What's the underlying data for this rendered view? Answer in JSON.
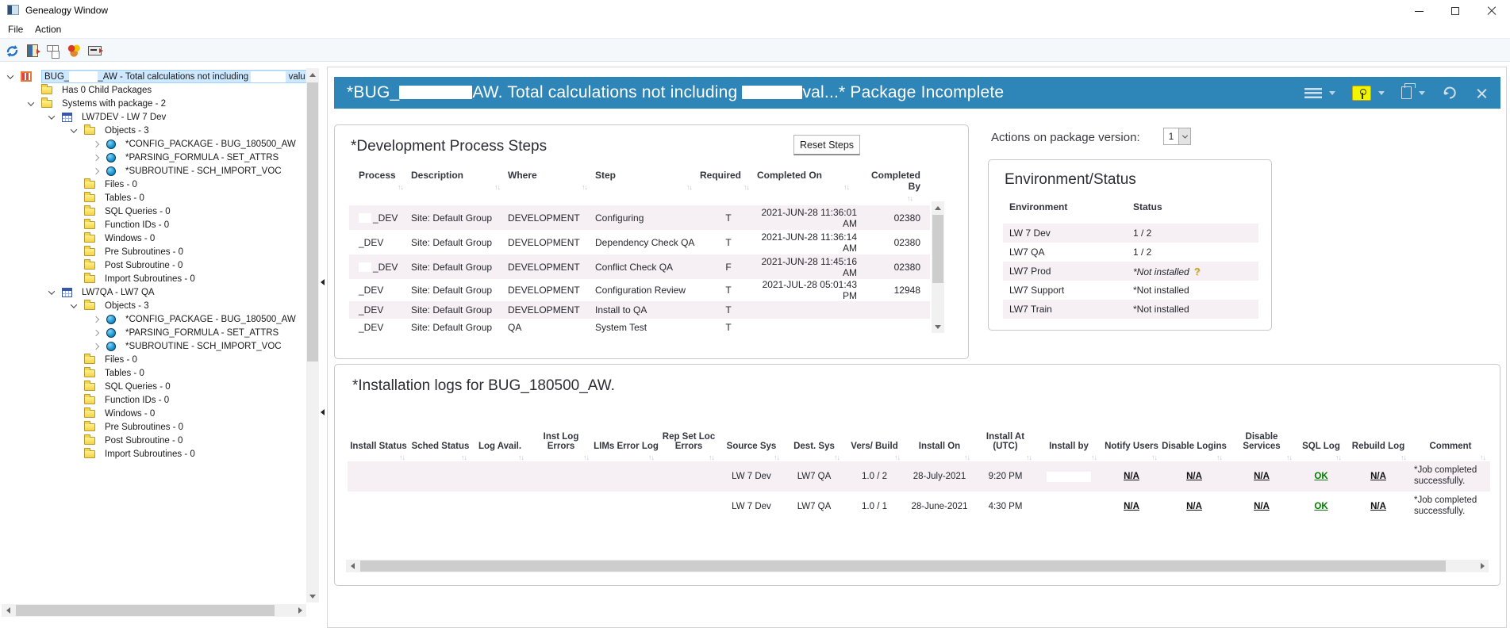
{
  "window": {
    "title": "Genealogy Window"
  },
  "menu": {
    "file": "File",
    "action": "Action"
  },
  "icons": {
    "sort": "↑↓",
    "help": "?"
  },
  "colors": {
    "accent_blue": "#2E86B8",
    "status_dot_green": "#17A24B",
    "ok_link_green": "#007D00",
    "highlight_yellow": "#F2F500",
    "row_alt": "#F6F0F4"
  },
  "tree": {
    "root_pre": "BUG_",
    "root_mid": "_AW - Total calculations not including",
    "root_post": "valu",
    "items": [
      "Has 0 Child Packages",
      "Systems with package - 2",
      "LW7DEV - LW 7 Dev",
      "Objects - 3",
      "*CONFIG_PACKAGE - BUG_180500_AW",
      "*PARSING_FORMULA - SET_ATTRS",
      "*SUBROUTINE - SCH_IMPORT_VOC",
      "Files - 0",
      "Tables - 0",
      "SQL Queries - 0",
      "Function IDs - 0",
      "Windows - 0",
      "Pre Subroutines - 0",
      "Post Subroutine - 0",
      "Import Subroutines - 0",
      "LW7QA - LW7 QA",
      "Objects - 3",
      "*CONFIG_PACKAGE - BUG_180500_AW",
      "*PARSING_FORMULA - SET_ATTRS",
      "*SUBROUTINE - SCH_IMPORT_VOC",
      "Files - 0",
      "Tables - 0",
      "SQL Queries - 0",
      "Function IDs - 0",
      "Windows - 0",
      "Pre Subroutines - 0",
      "Post Subroutine - 0",
      "Import Subroutines - 0"
    ]
  },
  "header": {
    "pre": "*BUG_",
    "mid": "AW. Total calculations not including",
    "post": "val...* Package Incomplete"
  },
  "dev_steps": {
    "title": "*Development Process Steps",
    "reset_button": "Reset Steps",
    "columns": [
      "Process",
      "Description",
      "Where",
      "Step",
      "Required",
      "Completed On",
      "Completed By"
    ],
    "rows": [
      {
        "process": "_DEV",
        "description": "Site: Default Group",
        "where": "DEVELOPMENT",
        "step": "Configuring",
        "required": "T",
        "completed_on": "2021-JUN-28 11:36:01 AM",
        "completed_by": "02380"
      },
      {
        "process": "_DEV",
        "description": "Site: Default Group",
        "where": "DEVELOPMENT",
        "step": "Dependency Check QA",
        "required": "T",
        "completed_on": "2021-JUN-28 11:36:14 AM",
        "completed_by": "02380"
      },
      {
        "process": "_DEV",
        "description": "Site: Default Group",
        "where": "DEVELOPMENT",
        "step": "Conflict Check QA",
        "required": "F",
        "completed_on": "2021-JUN-28 11:45:16 AM",
        "completed_by": "02380"
      },
      {
        "process": "_DEV",
        "description": "Site: Default Group",
        "where": "DEVELOPMENT",
        "step": "Configuration Review",
        "required": "T",
        "completed_on": "2021-JUL-28 05:01:43 PM",
        "completed_by": "12948"
      },
      {
        "process": "_DEV",
        "description": "Site: Default Group",
        "where": "DEVELOPMENT",
        "step": "Install to QA",
        "required": "T",
        "completed_on": "",
        "completed_by": ""
      },
      {
        "process": "_DEV",
        "description": "Site: Default Group",
        "where": "QA",
        "step": "System Test",
        "required": "T",
        "completed_on": "",
        "completed_by": ""
      }
    ]
  },
  "actions": {
    "label": "Actions on package version:",
    "version": "1"
  },
  "environment_status": {
    "title": "Environment/Status",
    "col_environment": "Environment",
    "col_status": "Status",
    "rows": [
      {
        "environment": "LW 7 Dev",
        "status": "1 / 2"
      },
      {
        "environment": "LW7 QA",
        "status": "1 / 2"
      },
      {
        "environment": "LW7 Prod",
        "status": "*Not installed"
      },
      {
        "environment": "LW7 Support",
        "status": "*Not installed"
      },
      {
        "environment": "LW7 Train",
        "status": "*Not installed"
      }
    ]
  },
  "install_logs": {
    "title": "*Installation logs for BUG_180500_AW.",
    "columns": [
      "Install Status",
      "Sched Status",
      "Log Avail.",
      "Inst Log Errors",
      "LIMs Error Log",
      "Rep Set Loc Errors",
      "Source Sys",
      "Dest. Sys",
      "Vers/ Build",
      "Install On",
      "Install At (UTC)",
      "Install by",
      "Notify Users",
      "Disable Logins",
      "Disable Services",
      "SQL Log",
      "Rebuild Log",
      "Comment"
    ],
    "rows": [
      {
        "source_sys": "LW 7 Dev",
        "dest_sys": "LW7 QA",
        "vers_build": "1.0 / 2",
        "install_on": "28-July-2021",
        "install_at": "9:20 PM",
        "notify_users": "N/A",
        "disable_logins": "N/A",
        "disable_services": "N/A",
        "sql_log": "OK",
        "rebuild_log": "N/A",
        "comment": "*Job completed successfully."
      },
      {
        "source_sys": "LW 7 Dev",
        "dest_sys": "LW7 QA",
        "vers_build": "1.0 / 1",
        "install_on": "28-June-2021",
        "install_at": "4:30 PM",
        "notify_users": "N/A",
        "disable_logins": "N/A",
        "disable_services": "N/A",
        "sql_log": "OK",
        "rebuild_log": "N/A",
        "comment": "*Job completed successfully."
      }
    ]
  }
}
